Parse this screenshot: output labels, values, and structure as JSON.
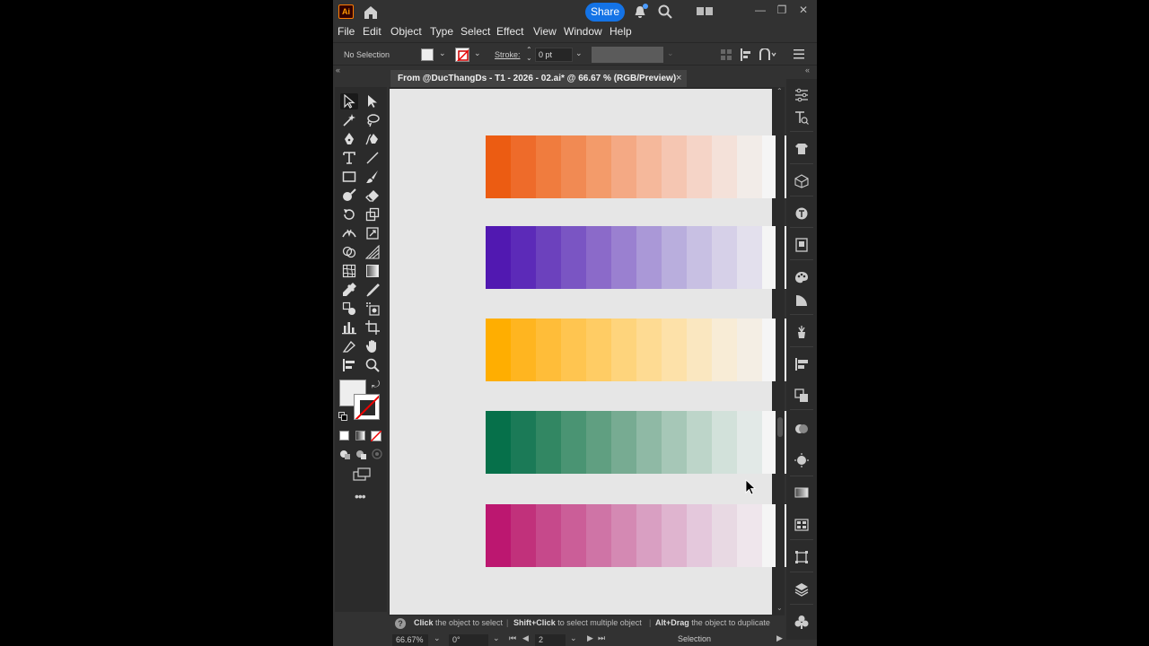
{
  "app": {
    "logo_text": "Ai",
    "share_label": "Share"
  },
  "menu": [
    "File",
    "Edit",
    "Object",
    "Type",
    "Select",
    "Effect",
    "View",
    "Window",
    "Help"
  ],
  "control_bar": {
    "selection_label": "No Selection",
    "stroke_label": "Stroke:",
    "stroke_value": "0 pt"
  },
  "document_tab": {
    "title": "From @DucThangDs - T1 - 2026 - 02.ai* @ 66.67 % (RGB/Preview)",
    "close": "×"
  },
  "color_ramps": [
    {
      "name": "orange",
      "colors": [
        "#ec5c12",
        "#ee6b2a",
        "#f07c3e",
        "#f18a53",
        "#f39b6a",
        "#f4a984",
        "#f5b89b",
        "#f5c6b2",
        "#f5d4c7",
        "#f4e1d9",
        "#f2ece8",
        "#f5f5f5"
      ]
    },
    {
      "name": "purple",
      "colors": [
        "#5118b1",
        "#5c2ab8",
        "#6c41bd",
        "#7a55c3",
        "#8b6ac9",
        "#9a80d0",
        "#aa98d7",
        "#b9aedd",
        "#c8c0e3",
        "#d6d0e8",
        "#e3e0ed",
        "#f5f5f5"
      ]
    },
    {
      "name": "amber",
      "colors": [
        "#ffae01",
        "#ffb520",
        "#ffbd39",
        "#ffc550",
        "#ffcc64",
        "#fed47c",
        "#fedb93",
        "#fde1a9",
        "#fae7c0",
        "#f8ecd6",
        "#f4eee4",
        "#f5f5f5"
      ]
    },
    {
      "name": "green",
      "colors": [
        "#06704a",
        "#1b7a57",
        "#328763",
        "#4a9473",
        "#609f81",
        "#77ab92",
        "#8fb9a5",
        "#a6c7b7",
        "#bdd5c9",
        "#d2e1da",
        "#e2e9e7",
        "#f5f5f5"
      ]
    },
    {
      "name": "magenta",
      "colors": [
        "#bc1770",
        "#c1317b",
        "#c6498b",
        "#cb5e98",
        "#cf74a6",
        "#d489b3",
        "#d99fc2",
        "#dfb4cf",
        "#e4c8dc",
        "#e8d9e3",
        "#efe6ec",
        "#f5f5f5"
      ]
    }
  ],
  "hint_bar": {
    "seg1_strong": "Click",
    "seg1_rest": " the object to select",
    "seg2_strong": "Shift+Click",
    "seg2_rest": " to select multiple object",
    "seg3_strong": "Alt+Drag",
    "seg3_rest": " the object to duplicate"
  },
  "status_bar": {
    "zoom": "66.67%",
    "rotation": "0°",
    "artboard": "2",
    "tool": "Selection"
  }
}
